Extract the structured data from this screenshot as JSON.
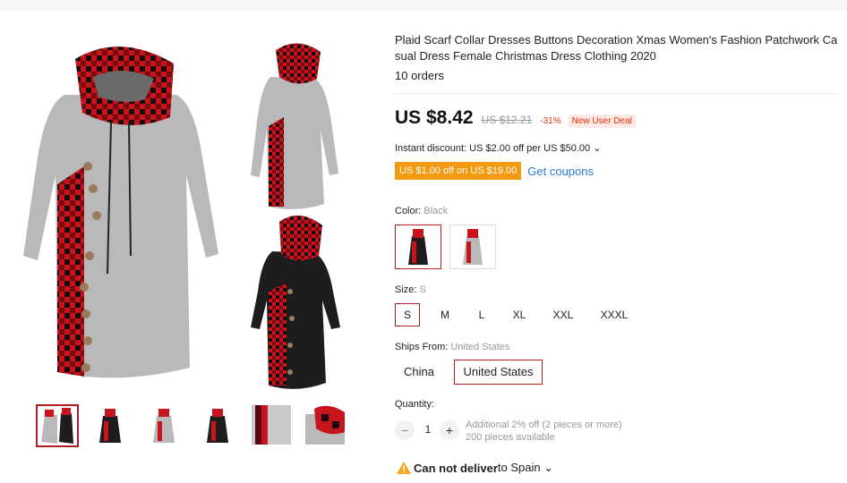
{
  "product": {
    "title_line1": "Plaid Scarf Collar Dresses Buttons Decoration Xmas Women's Fashion Patchwork Ca",
    "title_line2": "sual Dress Female Christmas Dress Clothing 2020",
    "orders": "10 orders"
  },
  "pricing": {
    "price": "US $8.42",
    "original_price": "US $12.21",
    "discount": "-31%",
    "badge": "New User Deal",
    "instant_discount": "Instant discount: US $2.00 off per US $50.00 ⌄",
    "coupon_badge": "US $1.00 off on US $19.00",
    "get_coupons": "Get coupons"
  },
  "color": {
    "label": "Color: ",
    "value": "Black",
    "options": [
      "black",
      "gray"
    ],
    "selected": 0
  },
  "size": {
    "label": "Size: ",
    "value": "S",
    "options": [
      "S",
      "M",
      "L",
      "XL",
      "XXL",
      "XXXL"
    ],
    "selected": 0
  },
  "ships_from": {
    "label": "Ships From: ",
    "value": "United States",
    "options": [
      "China",
      "United States"
    ],
    "selected": 1
  },
  "quantity": {
    "label": "Quantity:",
    "value": "1",
    "minus": "−",
    "plus": "+",
    "note_line1": "Additional 2% off (2 pieces or more)",
    "note_line2": "200 pieces available"
  },
  "delivery": {
    "strong": "Can not deliver",
    "rest": " to Spain ⌄",
    "icon": "warning-icon"
  },
  "colors": {
    "accent_red": "#b31d1d",
    "price_red": "#e62e04",
    "coupon_orange": "#f39a12",
    "link_blue": "#2a7bd3"
  }
}
